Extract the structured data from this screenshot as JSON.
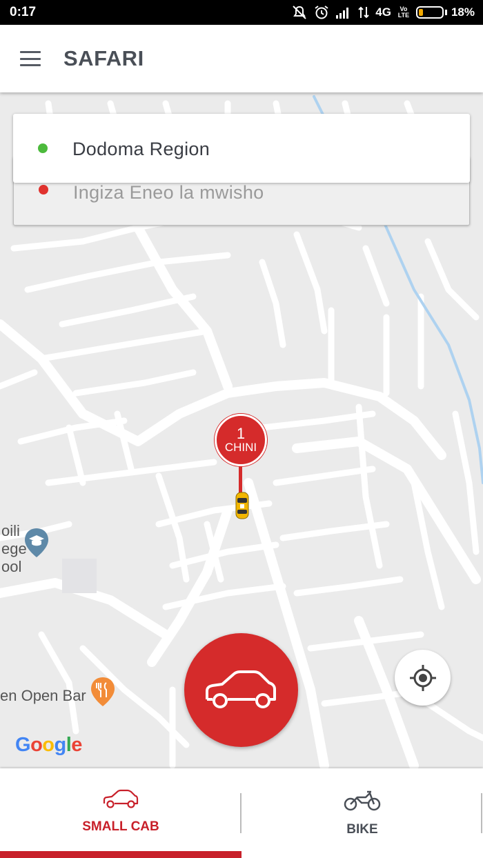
{
  "status_bar": {
    "time": "0:17",
    "network": "4G",
    "volte": "Vo LTE",
    "battery_percent": "18%",
    "battery_level": 0.18,
    "battery_color": "#f2a900"
  },
  "app_bar": {
    "title": "SAFARI",
    "menu_icon": "hamburger-menu-icon"
  },
  "locations": {
    "pickup_value": "Dodoma Region",
    "pickup_dot_color": "#4cba3c",
    "destination_placeholder": "Ingiza Eneo la mwisho",
    "destination_dot_color": "#e0322e"
  },
  "map": {
    "pin_count": "1",
    "pin_label": "CHINI",
    "poi_school_line1": "oili",
    "poi_school_line2": "ege",
    "poi_school_line3": "ool",
    "poi_bar": "en Open Bar",
    "attribution": "Google",
    "accent": "#d52b2b"
  },
  "fab": {
    "request_icon": "car-icon",
    "locate_icon": "my-location-icon"
  },
  "tabs": [
    {
      "label": "SMALL CAB",
      "icon": "car-icon",
      "active": true
    },
    {
      "label": "BIKE",
      "icon": "motorbike-icon",
      "active": false
    }
  ]
}
